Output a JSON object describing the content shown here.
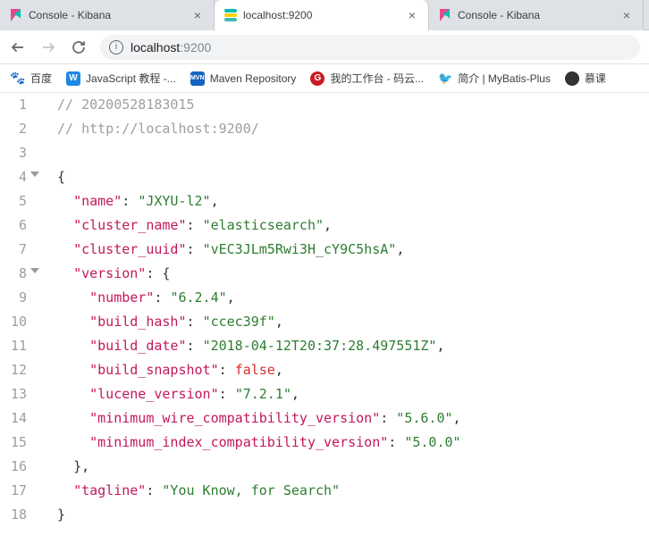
{
  "tabs": [
    {
      "title": "Console - Kibana",
      "favicon": "kibana",
      "active": false
    },
    {
      "title": "localhost:9200",
      "favicon": "es",
      "active": true
    },
    {
      "title": "Console - Kibana",
      "favicon": "kibana",
      "active": false
    }
  ],
  "address": {
    "host": "localhost",
    "port": ":9200"
  },
  "bookmarks": [
    {
      "label": "百度",
      "icon": "baidu"
    },
    {
      "label": "JavaScript 教程 -...",
      "icon": "w"
    },
    {
      "label": "Maven Repository",
      "icon": "mvn"
    },
    {
      "label": "我的工作台 - 码云...",
      "icon": "gitee"
    },
    {
      "label": "简介 | MyBatis-Plus",
      "icon": "mybatis"
    },
    {
      "label": "慕课",
      "icon": "imooc"
    }
  ],
  "code": {
    "comment1": "// 20200528183015",
    "comment2": "// http://localhost:9200/",
    "keys": {
      "name": "\"name\"",
      "cluster_name": "\"cluster_name\"",
      "cluster_uuid": "\"cluster_uuid\"",
      "version": "\"version\"",
      "number": "\"number\"",
      "build_hash": "\"build_hash\"",
      "build_date": "\"build_date\"",
      "build_snapshot": "\"build_snapshot\"",
      "lucene_version": "\"lucene_version\"",
      "min_wire": "\"minimum_wire_compatibility_version\"",
      "min_index": "\"minimum_index_compatibility_version\"",
      "tagline": "\"tagline\""
    },
    "vals": {
      "name": "\"JXYU-l2\"",
      "cluster_name": "\"elasticsearch\"",
      "cluster_uuid": "\"vEC3JLm5Rwi3H_cY9C5hsA\"",
      "number": "\"6.2.4\"",
      "build_hash": "\"ccec39f\"",
      "build_date": "\"2018-04-12T20:37:28.497551Z\"",
      "build_snapshot": "false",
      "lucene_version": "\"7.2.1\"",
      "min_wire": "\"5.6.0\"",
      "min_index": "\"5.0.0\"",
      "tagline": "\"You Know, for Search\""
    },
    "lines": [
      "1",
      "2",
      "3",
      "4",
      "5",
      "6",
      "7",
      "8",
      "9",
      "10",
      "11",
      "12",
      "13",
      "14",
      "15",
      "16",
      "17",
      "18"
    ]
  }
}
